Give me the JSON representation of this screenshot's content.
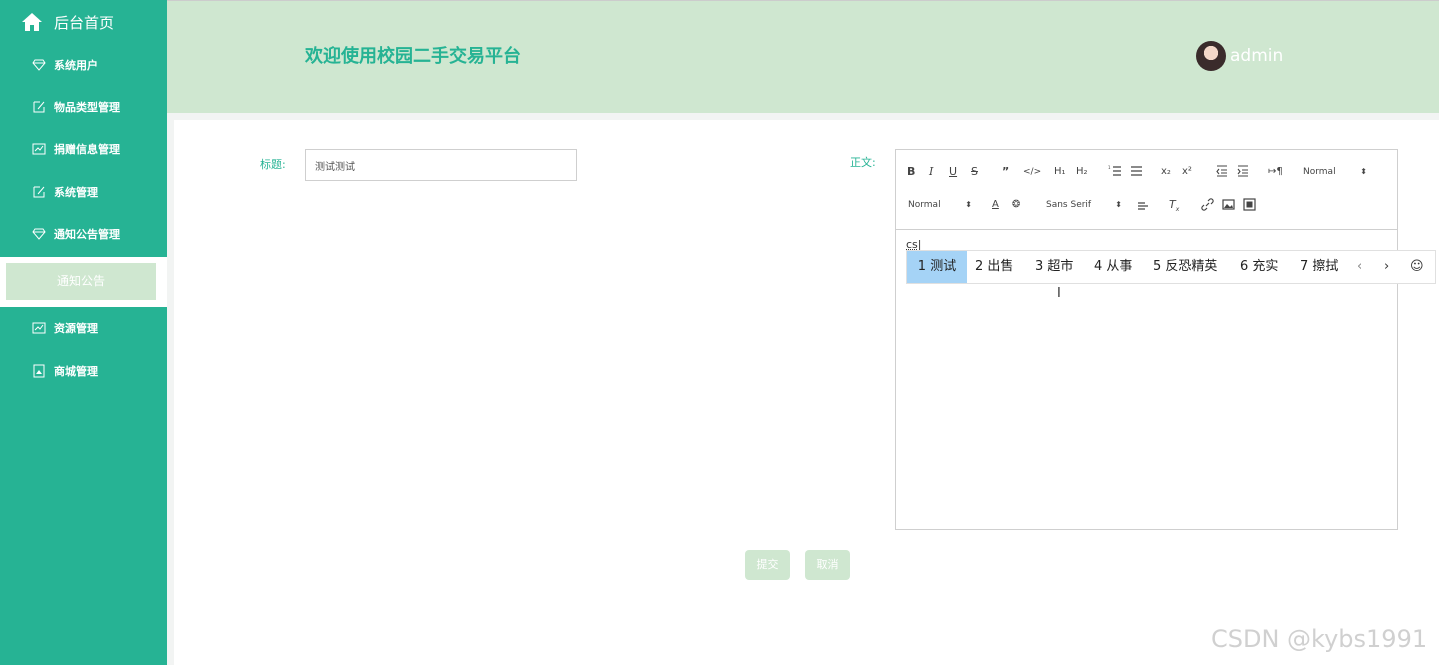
{
  "sidebar": {
    "home_label": "后台首页",
    "items": [
      {
        "label": "系统用户",
        "icon": "diamond-icon"
      },
      {
        "label": "物品类型管理",
        "icon": "edit-icon"
      },
      {
        "label": "捐赠信息管理",
        "icon": "chart-icon"
      },
      {
        "label": "系统管理",
        "icon": "edit-icon"
      },
      {
        "label": "通知公告管理",
        "icon": "diamond-icon"
      },
      {
        "label": "资源管理",
        "icon": "chart-icon"
      },
      {
        "label": "商城管理",
        "icon": "picture-icon"
      }
    ],
    "active_subitem": "通知公告"
  },
  "header": {
    "title": "欢迎使用校园二手交易平台",
    "username": "admin"
  },
  "form": {
    "title_label": "标题:",
    "title_value": "测试测试",
    "body_label": "正文:",
    "submit_label": "提交",
    "cancel_label": "取消"
  },
  "editor": {
    "header_select": "Normal",
    "size_select": "Normal",
    "font_select": "Sans Serif",
    "content": "cs"
  },
  "ime": {
    "candidates": [
      {
        "num": "1",
        "text": "测试"
      },
      {
        "num": "2",
        "text": "出售"
      },
      {
        "num": "3",
        "text": "超市"
      },
      {
        "num": "4",
        "text": "从事"
      },
      {
        "num": "5",
        "text": "反恐精英"
      },
      {
        "num": "6",
        "text": "充实"
      },
      {
        "num": "7",
        "text": "擦拭"
      }
    ]
  },
  "watermark": "CSDN @kybs1991",
  "colors": {
    "primary": "#26b394",
    "header_bg": "#cfe7d0",
    "ime_highlight": "#a5d3f6"
  }
}
